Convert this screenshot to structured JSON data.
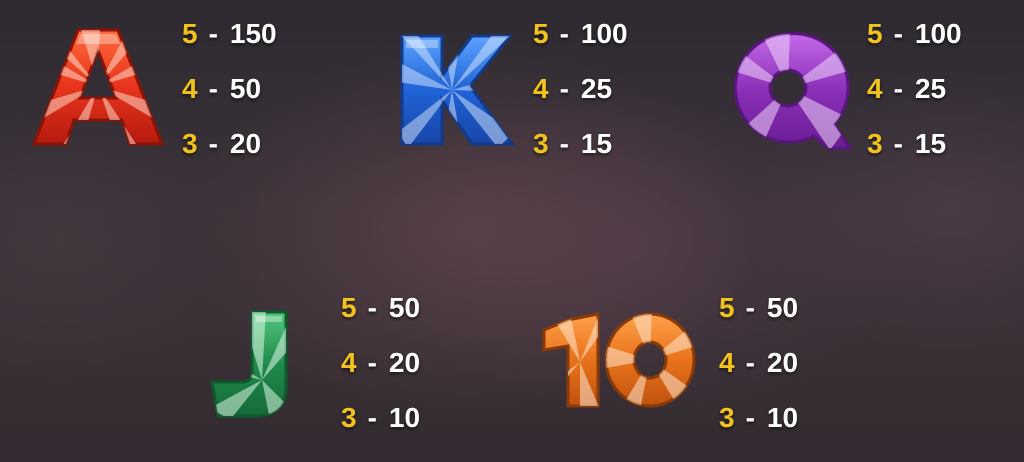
{
  "paytable": {
    "colors": {
      "count": "#f2c31d",
      "payout": "#ffffff"
    },
    "symbols": [
      {
        "id": "A",
        "name": "letter-a",
        "icon": "candy-letter-a-icon",
        "color": "#e8341c",
        "payouts": [
          {
            "count": "5",
            "value": "150"
          },
          {
            "count": "4",
            "value": "50"
          },
          {
            "count": "3",
            "value": "20"
          }
        ]
      },
      {
        "id": "K",
        "name": "letter-k",
        "icon": "candy-letter-k-icon",
        "color": "#1f63d6",
        "payouts": [
          {
            "count": "5",
            "value": "100"
          },
          {
            "count": "4",
            "value": "25"
          },
          {
            "count": "3",
            "value": "15"
          }
        ]
      },
      {
        "id": "Q",
        "name": "letter-q",
        "icon": "candy-letter-q-icon",
        "color": "#8a2fb8",
        "payouts": [
          {
            "count": "5",
            "value": "100"
          },
          {
            "count": "4",
            "value": "25"
          },
          {
            "count": "3",
            "value": "15"
          }
        ]
      },
      {
        "id": "J",
        "name": "letter-j",
        "icon": "candy-letter-j-icon",
        "color": "#1f8a4c",
        "payouts": [
          {
            "count": "5",
            "value": "50"
          },
          {
            "count": "4",
            "value": "20"
          },
          {
            "count": "3",
            "value": "10"
          }
        ]
      },
      {
        "id": "10",
        "name": "number-10",
        "icon": "candy-number-10-icon",
        "color": "#e8731c",
        "payouts": [
          {
            "count": "5",
            "value": "50"
          },
          {
            "count": "4",
            "value": "20"
          },
          {
            "count": "3",
            "value": "10"
          }
        ]
      }
    ]
  }
}
